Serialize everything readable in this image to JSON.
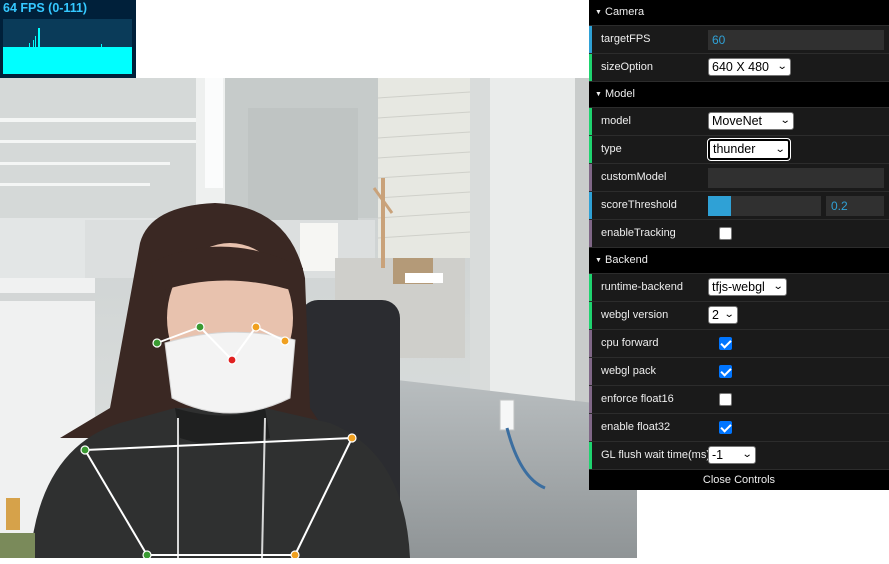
{
  "stats": {
    "fps_text": "64 FPS (0-111)"
  },
  "gui": {
    "colors": {
      "number_bar": "#2fa1d6",
      "select_bar": "#1ed36f",
      "text_bar": "#806787",
      "boolean_bar": "#806787",
      "function_bar": "#e61d5f"
    },
    "camera": {
      "title": "Camera",
      "target_fps": {
        "label": "targetFPS",
        "value": "60"
      },
      "size_option": {
        "label": "sizeOption",
        "value": "640 X 480"
      }
    },
    "model": {
      "title": "Model",
      "model": {
        "label": "model",
        "value": "MoveNet"
      },
      "type": {
        "label": "type",
        "value": "thunder"
      },
      "custom_model": {
        "label": "customModel",
        "value": ""
      },
      "score_threshold": {
        "label": "scoreThreshold",
        "value": "0.2"
      },
      "enable_tracking": {
        "label": "enableTracking",
        "checked": false
      }
    },
    "backend": {
      "title": "Backend",
      "runtime": {
        "label": "runtime-backend",
        "value": "tfjs-webgl"
      },
      "webgl_version": {
        "label": "webgl version",
        "value": "2"
      },
      "cpu_forward": {
        "label": "cpu forward",
        "checked": true
      },
      "webgl_pack": {
        "label": "webgl pack",
        "checked": true
      },
      "enforce_float16": {
        "label": "enforce float16",
        "checked": false
      },
      "enable_float32": {
        "label": "enable float32",
        "checked": true
      },
      "gl_flush": {
        "label": "GL flush wait time(ms)",
        "value": "-1"
      }
    },
    "close_label": "Close Controls"
  },
  "pose": {
    "left_color": "#3a9a32",
    "right_color": "#f0a020",
    "middle_color": "#e02020",
    "line_color": "#ffffff"
  }
}
